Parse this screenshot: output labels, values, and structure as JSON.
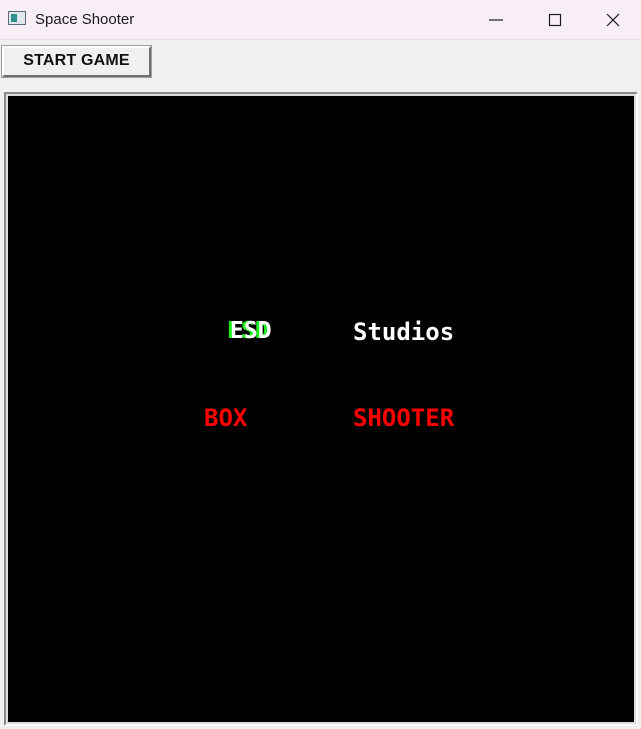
{
  "window": {
    "title": "Space Shooter",
    "icon": "app-window-icon",
    "controls": [
      "minimize-icon",
      "maximize-icon",
      "close-icon"
    ]
  },
  "toolbar": {
    "start_label": "START GAME"
  },
  "game": {
    "background_color": "#000000",
    "splash": {
      "line1_left": "ESD",
      "line1_right": "Studios",
      "line2_left": "BOX",
      "line2_right": "SHOOTER",
      "colors": {
        "esd": "#ffffff",
        "esd_accent": "#22ee22",
        "studios": "#ffffff",
        "box": "#ff0000",
        "shooter": "#ff0000"
      }
    }
  }
}
